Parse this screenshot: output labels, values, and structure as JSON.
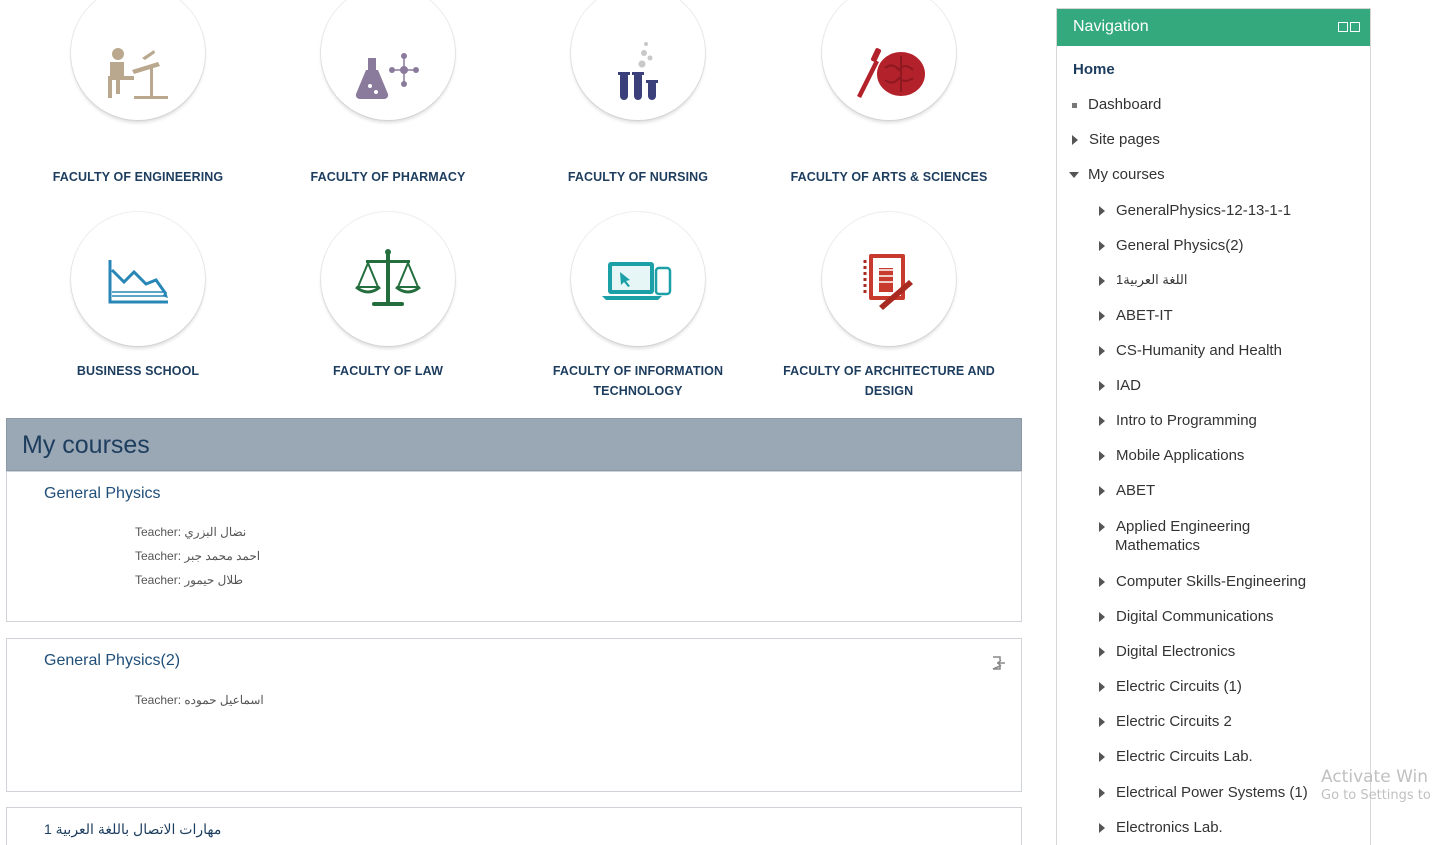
{
  "faculties": [
    {
      "name": "FACULTY OF ENGINEERING",
      "icon": "engineer-at-drafting-table-icon"
    },
    {
      "name": "FACULTY OF PHARMACY",
      "icon": "flask-molecule-icon"
    },
    {
      "name": "FACULTY OF NURSING",
      "icon": "test-tubes-icon"
    },
    {
      "name": "FACULTY OF ARTS & SCIENCES",
      "icon": "brush-brain-icon"
    },
    {
      "name": "BUSINESS SCHOOL",
      "icon": "declining-chart-icon"
    },
    {
      "name": "FACULTY OF LAW",
      "icon": "scales-of-justice-icon"
    },
    {
      "name": "FACULTY OF INFORMATION TECHNOLOGY",
      "icon": "laptop-phone-icon"
    },
    {
      "name": "FACULTY OF ARCHITECTURE AND DESIGN",
      "icon": "architecture-notebook-icon"
    }
  ],
  "my_courses": {
    "heading": "My courses",
    "courses": [
      {
        "title": "General Physics",
        "teacher_label": "Teacher:",
        "teachers": [
          "نضال البزري",
          "احمد محمد جبر",
          "طلال حيمور"
        ]
      },
      {
        "title": "General Physics(2)",
        "teacher_label": "Teacher:",
        "teachers": [
          "اسماعيل حموده"
        ],
        "unenrol_icon": "unenrol-icon"
      },
      {
        "title": "مهارات الاتصال باللغة العربية 1"
      }
    ]
  },
  "navigation": {
    "title": "Navigation",
    "home": "Home",
    "dashboard": "Dashboard",
    "site_pages": "Site pages",
    "my_courses": "My courses",
    "course_items": [
      "GeneralPhysics-12-13-1-1",
      "General Physics(2)",
      "اللغة العربية1",
      "ABET-IT",
      "CS-Humanity and Health",
      "IAD",
      "Intro to Programming",
      "Mobile Applications",
      "ABET",
      "Applied Engineering",
      "Mathematics",
      "Computer Skills-Engineering",
      "Digital Communications",
      "Digital Electronics",
      "Electric Circuits (1)",
      "Electric Circuits 2",
      "Electric Circuits Lab.",
      "Electrical Power Systems (1)",
      "Electronics Lab."
    ]
  },
  "watermark": {
    "line1": "Activate Win",
    "line2": "Go to Settings to"
  },
  "colors": {
    "nav_header": "#34a97e",
    "courses_header": "#9aa7b4",
    "title_blue": "#1d3d5e"
  }
}
